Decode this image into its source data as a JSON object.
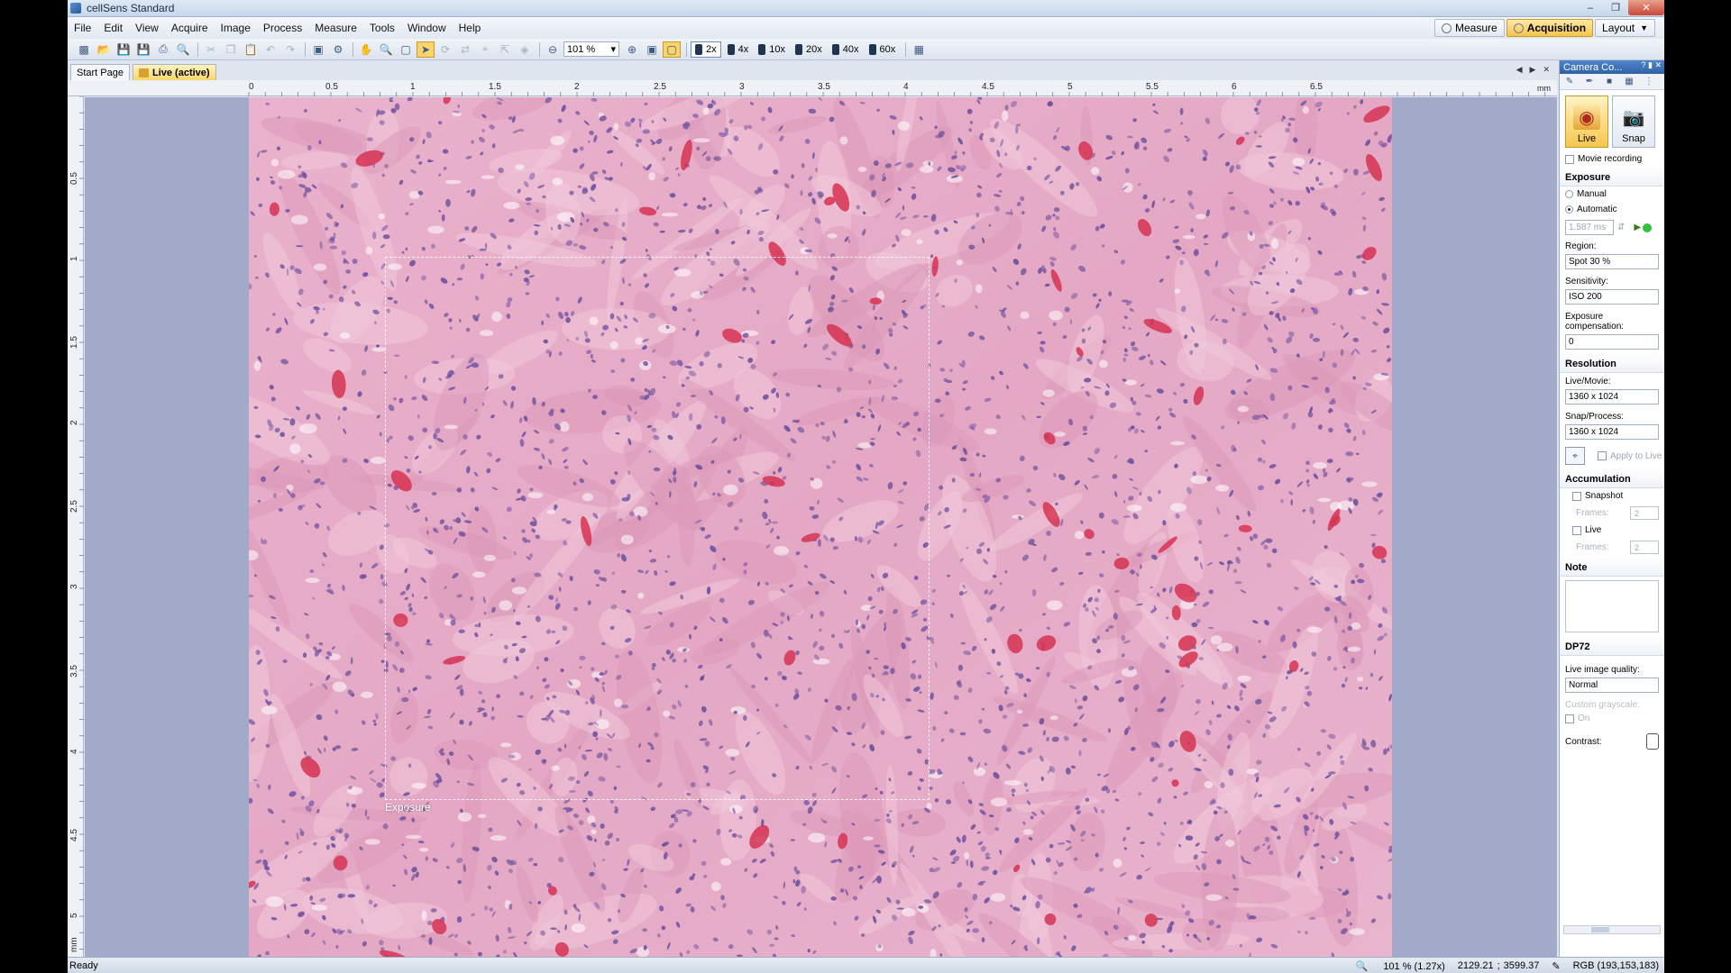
{
  "window": {
    "title": "cellSens Standard"
  },
  "menu": [
    "File",
    "Edit",
    "View",
    "Acquire",
    "Image",
    "Process",
    "Measure",
    "Tools",
    "Window",
    "Help"
  ],
  "layouts": {
    "measure": "Measure",
    "acquisition": "Acquisition",
    "layout": "Layout"
  },
  "toolbar": {
    "zoom_value": "101 %",
    "objectives": [
      {
        "label": "2x",
        "active": true
      },
      {
        "label": "4x",
        "active": false
      },
      {
        "label": "10x",
        "active": false
      },
      {
        "label": "20x",
        "active": false
      },
      {
        "label": "40x",
        "active": false
      },
      {
        "label": "60x",
        "active": false
      }
    ]
  },
  "doc_tabs": {
    "start": "Start Page",
    "live": "Live (active)"
  },
  "ruler": {
    "unit": "mm",
    "h_ticks": [
      "0",
      "0.5",
      "1",
      "1.5",
      "2",
      "2.5",
      "3",
      "3.5",
      "4",
      "4.5",
      "5",
      "5.5",
      "6",
      "6.5"
    ],
    "v_ticks": [
      "0.5",
      "1",
      "1.5",
      "2",
      "2.5",
      "3",
      "3.5",
      "4",
      "4.5",
      "5"
    ],
    "v_unit": "mm"
  },
  "canvas": {
    "roi_label": "Exposure"
  },
  "status": {
    "ready": "Ready",
    "zoom": "101 % (1.27x)",
    "x": "2129.21",
    "sep": ";",
    "y": "3599.37",
    "rgb": "RGB (193,153,183)"
  },
  "panel": {
    "title": "Camera Co...",
    "live": "Live",
    "snap": "Snap",
    "movie_recording": "Movie recording",
    "exposure": {
      "title": "Exposure",
      "manual": "Manual",
      "automatic": "Automatic",
      "time": "1.587 ms",
      "region_label": "Region:",
      "region": "Spot 30 %",
      "sensitivity_label": "Sensitivity:",
      "sensitivity": "ISO 200",
      "compensation_label": "Exposure compensation:",
      "compensation": "0"
    },
    "resolution": {
      "title": "Resolution",
      "live_label": "Live/Movie:",
      "live": "1360 x 1024",
      "snap_label": "Snap/Process:",
      "snap": "1360 x 1024",
      "apply": "Apply to Live"
    },
    "accumulation": {
      "title": "Accumulation",
      "snapshot": "Snapshot",
      "frames_label": "Frames:",
      "frames_snapshot": "2",
      "live": "Live",
      "frames_live": "2"
    },
    "note": {
      "title": "Note"
    },
    "camera": {
      "title": "DP72",
      "quality_label": "Live image quality:",
      "quality": "Normal",
      "grayscale_label": "Custom grayscale:",
      "on_label": "On",
      "contrast_label": "Contrast:"
    }
  },
  "colors": {
    "tissue": "#e8a3c0",
    "nuclei": "#6b4f9e",
    "vessel": "#d63252",
    "canvas_bg": "#a3a9c8"
  }
}
